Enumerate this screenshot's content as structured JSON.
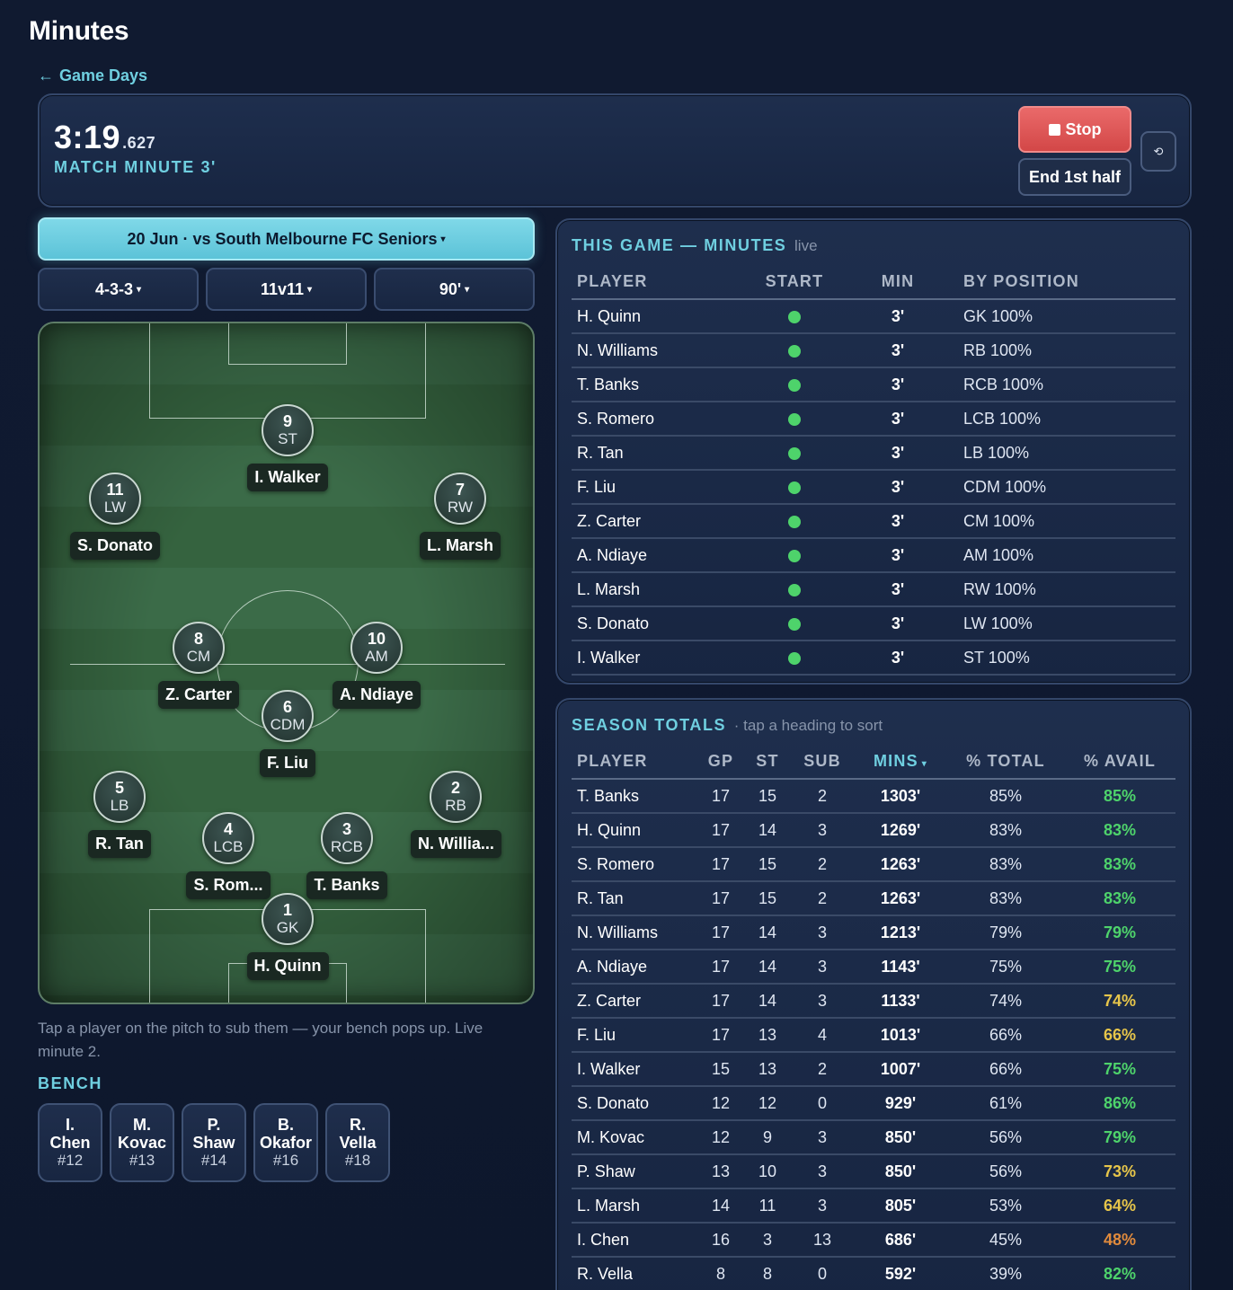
{
  "page": {
    "title": "Minutes",
    "back_label": "Game Days"
  },
  "clock": {
    "time": "3:19",
    "ms": ".627",
    "minute_label": "MATCH MINUTE 3'"
  },
  "actions": {
    "stop": "Stop",
    "end_half": "End 1st half",
    "undo_icon": "⟲"
  },
  "selectors": {
    "fixture": "20 Jun · vs South Melbourne FC Seniors",
    "formation": "4-3-3",
    "format": "11v11",
    "duration": "90'"
  },
  "pitch": {
    "players": [
      {
        "num": "9",
        "pos": "ST",
        "name": "I. Walker"
      },
      {
        "num": "11",
        "pos": "LW",
        "name": "S. Donato"
      },
      {
        "num": "7",
        "pos": "RW",
        "name": "L. Marsh"
      },
      {
        "num": "8",
        "pos": "CM",
        "name": "Z. Carter"
      },
      {
        "num": "10",
        "pos": "AM",
        "name": "A. Ndiaye"
      },
      {
        "num": "6",
        "pos": "CDM",
        "name": "F. Liu"
      },
      {
        "num": "5",
        "pos": "LB",
        "name": "R. Tan"
      },
      {
        "num": "2",
        "pos": "RB",
        "name": "N. Willia..."
      },
      {
        "num": "4",
        "pos": "LCB",
        "name": "S. Rom..."
      },
      {
        "num": "3",
        "pos": "RCB",
        "name": "T. Banks"
      },
      {
        "num": "1",
        "pos": "GK",
        "name": "H. Quinn"
      }
    ]
  },
  "hint": "Tap a player on the pitch to sub them — your bench pops up. Live minute 2.",
  "bench": {
    "title": "BENCH",
    "players": [
      {
        "first": "I.",
        "last": "Chen",
        "num": "#12"
      },
      {
        "first": "M.",
        "last": "Kovac",
        "num": "#13"
      },
      {
        "first": "P.",
        "last": "Shaw",
        "num": "#14"
      },
      {
        "first": "B.",
        "last": "Okafor",
        "num": "#16"
      },
      {
        "first": "R.",
        "last": "Vella",
        "num": "#18"
      }
    ]
  },
  "this_game": {
    "title": "THIS GAME — MINUTES",
    "subtitle": "live",
    "headers": {
      "player": "PLAYER",
      "start": "START",
      "min": "MIN",
      "by_position": "BY POSITION"
    },
    "rows": [
      {
        "player": "H. Quinn",
        "min": "3'",
        "pos": "GK 100%"
      },
      {
        "player": "N. Williams",
        "min": "3'",
        "pos": "RB 100%"
      },
      {
        "player": "T. Banks",
        "min": "3'",
        "pos": "RCB 100%"
      },
      {
        "player": "S. Romero",
        "min": "3'",
        "pos": "LCB 100%"
      },
      {
        "player": "R. Tan",
        "min": "3'",
        "pos": "LB 100%"
      },
      {
        "player": "F. Liu",
        "min": "3'",
        "pos": "CDM 100%"
      },
      {
        "player": "Z. Carter",
        "min": "3'",
        "pos": "CM 100%"
      },
      {
        "player": "A. Ndiaye",
        "min": "3'",
        "pos": "AM 100%"
      },
      {
        "player": "L. Marsh",
        "min": "3'",
        "pos": "RW 100%"
      },
      {
        "player": "S. Donato",
        "min": "3'",
        "pos": "LW 100%"
      },
      {
        "player": "I. Walker",
        "min": "3'",
        "pos": "ST 100%"
      }
    ]
  },
  "season": {
    "title": "SEASON TOTALS",
    "subtitle": "· tap a heading to sort",
    "headers": {
      "player": "PLAYER",
      "gp": "GP",
      "st": "ST",
      "sub": "SUB",
      "mins": "MINS",
      "pct_total": "% TOTAL",
      "pct_avail": "% AVAIL"
    },
    "rows": [
      {
        "player": "T. Banks",
        "gp": "17",
        "st": "15",
        "sub": "2",
        "mins": "1303'",
        "pct_total": "85%",
        "pct_avail": "85%",
        "color": "#4ed36b"
      },
      {
        "player": "H. Quinn",
        "gp": "17",
        "st": "14",
        "sub": "3",
        "mins": "1269'",
        "pct_total": "83%",
        "pct_avail": "83%",
        "color": "#4ed36b"
      },
      {
        "player": "S. Romero",
        "gp": "17",
        "st": "15",
        "sub": "2",
        "mins": "1263'",
        "pct_total": "83%",
        "pct_avail": "83%",
        "color": "#4ed36b"
      },
      {
        "player": "R. Tan",
        "gp": "17",
        "st": "15",
        "sub": "2",
        "mins": "1263'",
        "pct_total": "83%",
        "pct_avail": "83%",
        "color": "#4ed36b"
      },
      {
        "player": "N. Williams",
        "gp": "17",
        "st": "14",
        "sub": "3",
        "mins": "1213'",
        "pct_total": "79%",
        "pct_avail": "79%",
        "color": "#4ed36b"
      },
      {
        "player": "A. Ndiaye",
        "gp": "17",
        "st": "14",
        "sub": "3",
        "mins": "1143'",
        "pct_total": "75%",
        "pct_avail": "75%",
        "color": "#4ed36b"
      },
      {
        "player": "Z. Carter",
        "gp": "17",
        "st": "14",
        "sub": "3",
        "mins": "1133'",
        "pct_total": "74%",
        "pct_avail": "74%",
        "color": "#e6c54a"
      },
      {
        "player": "F. Liu",
        "gp": "17",
        "st": "13",
        "sub": "4",
        "mins": "1013'",
        "pct_total": "66%",
        "pct_avail": "66%",
        "color": "#e6c54a"
      },
      {
        "player": "I. Walker",
        "gp": "15",
        "st": "13",
        "sub": "2",
        "mins": "1007'",
        "pct_total": "66%",
        "pct_avail": "75%",
        "color": "#4ed36b"
      },
      {
        "player": "S. Donato",
        "gp": "12",
        "st": "12",
        "sub": "0",
        "mins": "929'",
        "pct_total": "61%",
        "pct_avail": "86%",
        "color": "#4ed36b"
      },
      {
        "player": "M. Kovac",
        "gp": "12",
        "st": "9",
        "sub": "3",
        "mins": "850'",
        "pct_total": "56%",
        "pct_avail": "79%",
        "color": "#4ed36b"
      },
      {
        "player": "P. Shaw",
        "gp": "13",
        "st": "10",
        "sub": "3",
        "mins": "850'",
        "pct_total": "56%",
        "pct_avail": "73%",
        "color": "#e6c54a"
      },
      {
        "player": "L. Marsh",
        "gp": "14",
        "st": "11",
        "sub": "3",
        "mins": "805'",
        "pct_total": "53%",
        "pct_avail": "64%",
        "color": "#e6c54a"
      },
      {
        "player": "I. Chen",
        "gp": "16",
        "st": "3",
        "sub": "13",
        "mins": "686'",
        "pct_total": "45%",
        "pct_avail": "48%",
        "color": "#e08a3c"
      },
      {
        "player": "R. Vella",
        "gp": "8",
        "st": "8",
        "sub": "0",
        "mins": "592'",
        "pct_total": "39%",
        "pct_avail": "82%",
        "color": "#4ed36b"
      }
    ]
  }
}
